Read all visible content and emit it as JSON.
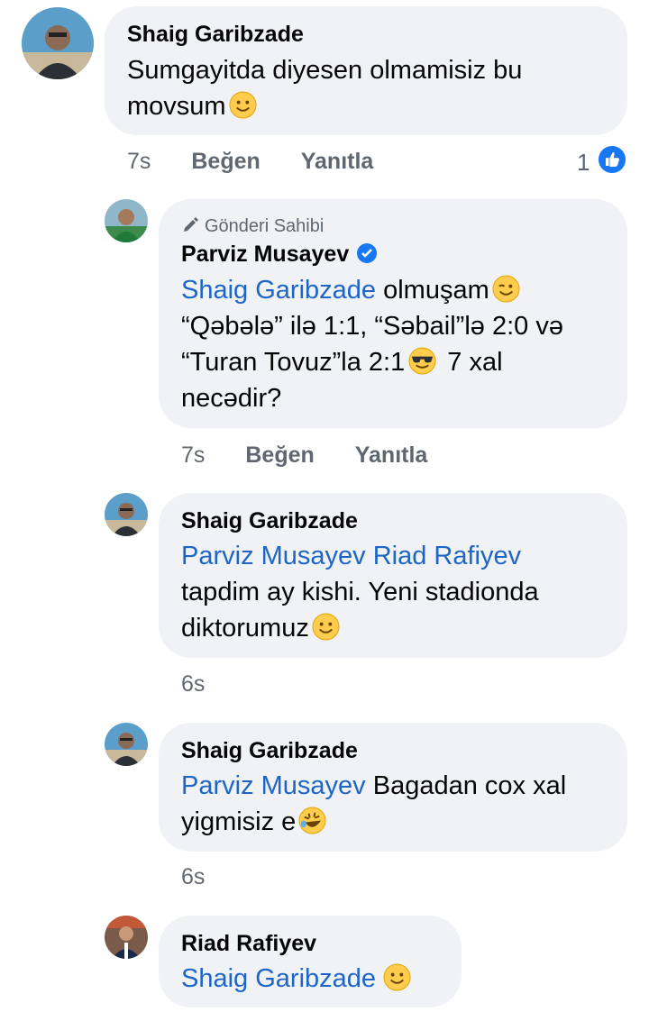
{
  "comments": [
    {
      "author": "Shaig Garibzade",
      "lines": [
        {
          "mention": "",
          "text": "Sumgayitda diyesen olmamisiz bu",
          "emoji": ""
        },
        {
          "mention": "",
          "text": "movsum",
          "emoji": "smile"
        }
      ],
      "time": "7s",
      "like_label": "Beğen",
      "reply_label": "Yanıtla",
      "reaction_count": "1"
    },
    {
      "owner_badge": "Gönderi Sahibi",
      "author": "Parviz Musayev",
      "verified": true,
      "lines": [
        {
          "mention": "Shaig Garibzade",
          "text": " olmuşam",
          "emoji": "wink"
        },
        {
          "mention": "",
          "text": "“Qəbələ” ilə 1:1, “Səbail”lə 2:0 və",
          "emoji": ""
        },
        {
          "mention": "",
          "text": "“Turan Tovuz”la 2:1",
          "emoji": "cool",
          "after": " 7 xal"
        },
        {
          "mention": "",
          "text": "necədir?",
          "emoji": ""
        }
      ],
      "time": "7s",
      "like_label": "Beğen",
      "reply_label": "Yanıtla"
    },
    {
      "author": "Shaig Garibzade",
      "lines": [
        {
          "mention": "Parviz Musayev Riad Rafiyev",
          "text": "",
          "emoji": ""
        },
        {
          "mention": "",
          "text": "tapdim ay kishi. Yeni stadionda",
          "emoji": ""
        },
        {
          "mention": "",
          "text": "diktorumuz",
          "emoji": "smile"
        }
      ],
      "time": "6s"
    },
    {
      "author": "Shaig Garibzade",
      "lines": [
        {
          "mention": "Parviz Musayev",
          "text": " Bagadan cox xal",
          "emoji": ""
        },
        {
          "mention": "",
          "text": "yigmisiz e",
          "emoji": "rofl"
        }
      ],
      "time": "6s"
    },
    {
      "author": "Riad Rafiyev",
      "lines": [
        {
          "mention": "Shaig Garibzade",
          "text": "",
          "emoji": "smile"
        }
      ]
    }
  ],
  "colors": {
    "bubble": "#f0f2f5",
    "mention": "#1d66c8",
    "meta": "#606770",
    "like_blue": "#1877f2"
  }
}
